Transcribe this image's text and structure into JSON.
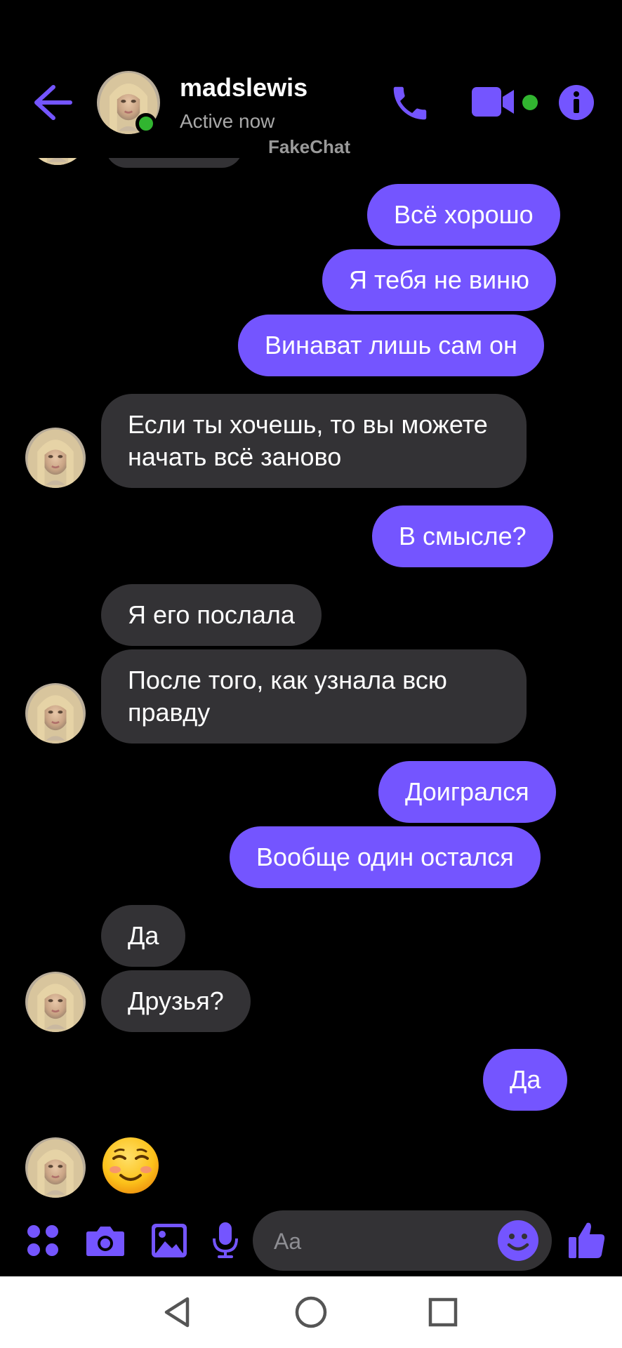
{
  "header": {
    "contact_name": "madslewis",
    "status": "Active now",
    "watermark": "FakeChat",
    "icons": {
      "back": "back-arrow-icon",
      "call": "phone-icon",
      "video": "video-camera-icon",
      "info": "info-icon"
    }
  },
  "messages": [
    {
      "direction": "out",
      "text": "Всё хорошо"
    },
    {
      "direction": "out",
      "text": "Я тебя не виню"
    },
    {
      "direction": "out",
      "text": "Винават лишь сам он"
    },
    {
      "direction": "in",
      "text": "Если ты хочешь, то вы можете начать всё заново"
    },
    {
      "direction": "out",
      "text": "В смысле?"
    },
    {
      "direction": "in",
      "text": "Я его послала"
    },
    {
      "direction": "in",
      "text": "После того, как узнала всю правду"
    },
    {
      "direction": "out",
      "text": "Доигрался"
    },
    {
      "direction": "out",
      "text": "Вообще один остался"
    },
    {
      "direction": "in",
      "text": "Да"
    },
    {
      "direction": "in",
      "text": "Друзья?"
    },
    {
      "direction": "out",
      "text": "Да"
    },
    {
      "direction": "in",
      "type": "emoji",
      "emoji": "relieved-smiling-face"
    }
  ],
  "composer": {
    "placeholder": "Aa",
    "icons": [
      "menu-dots-icon",
      "camera-icon",
      "gallery-icon",
      "microphone-icon",
      "emoji-icon",
      "thumbs-up-icon"
    ]
  },
  "navbar": {
    "icons": [
      "back-triangle-icon",
      "home-circle-icon",
      "recents-square-icon"
    ]
  },
  "colors": {
    "accent": "#7455ff",
    "bubble_in": "#333235",
    "background": "#000000",
    "online": "#31b530"
  }
}
